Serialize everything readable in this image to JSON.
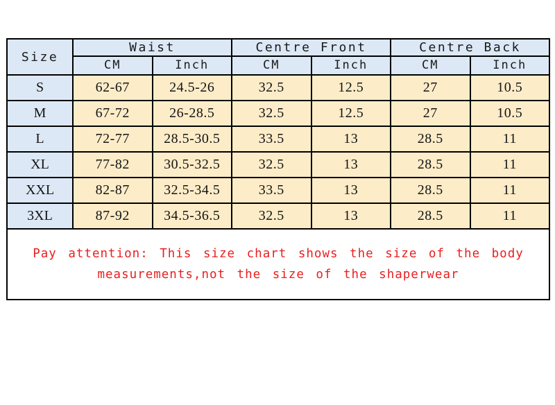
{
  "table": {
    "size_header": "Size",
    "groups": [
      {
        "label": "Waist",
        "units": [
          "CM",
          "Inch"
        ]
      },
      {
        "label": "Centre Front",
        "units": [
          "CM",
          "Inch"
        ]
      },
      {
        "label": "Centre Back",
        "units": [
          "CM",
          "Inch"
        ]
      }
    ],
    "rows": [
      {
        "size": "S",
        "waist_cm": "62-67",
        "waist_inch": "24.5-26",
        "cf_cm": "32.5",
        "cf_inch": "12.5",
        "cb_cm": "27",
        "cb_inch": "10.5"
      },
      {
        "size": "M",
        "waist_cm": "67-72",
        "waist_inch": "26-28.5",
        "cf_cm": "32.5",
        "cf_inch": "12.5",
        "cb_cm": "27",
        "cb_inch": "10.5"
      },
      {
        "size": "L",
        "waist_cm": "72-77",
        "waist_inch": "28.5-30.5",
        "cf_cm": "33.5",
        "cf_inch": "13",
        "cb_cm": "28.5",
        "cb_inch": "11"
      },
      {
        "size": "XL",
        "waist_cm": "77-82",
        "waist_inch": "30.5-32.5",
        "cf_cm": "32.5",
        "cf_inch": "13",
        "cb_cm": "28.5",
        "cb_inch": "11"
      },
      {
        "size": "XXL",
        "waist_cm": "82-87",
        "waist_inch": "32.5-34.5",
        "cf_cm": "33.5",
        "cf_inch": "13",
        "cb_cm": "28.5",
        "cb_inch": "11"
      },
      {
        "size": "3XL",
        "waist_cm": "87-92",
        "waist_inch": "34.5-36.5",
        "cf_cm": "32.5",
        "cf_inch": "13",
        "cb_cm": "28.5",
        "cb_inch": "11"
      }
    ],
    "note": {
      "line1": "Pay attention: This size chart shows the size of the body",
      "line2": "measurements,not the size of the shaperwear"
    }
  },
  "colors": {
    "header_blue": "#dce8f5",
    "cell_cream": "#fcecc8",
    "note_red": "#e8201f",
    "border": "#000000",
    "page_background": "#ffffff"
  }
}
